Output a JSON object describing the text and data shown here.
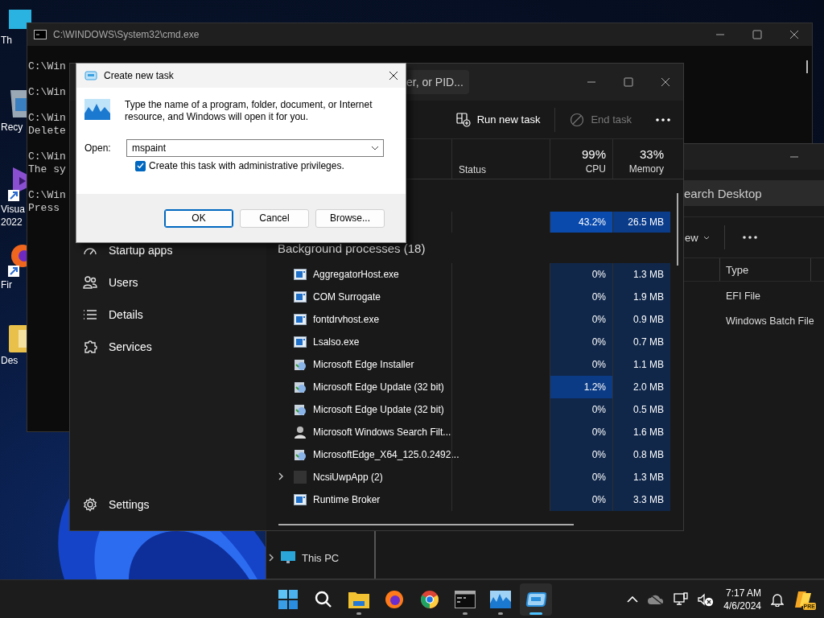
{
  "desktop": {
    "icons": [
      {
        "label": "Th",
        "kind": "monitor"
      },
      {
        "label": "Recy",
        "kind": "bin"
      },
      {
        "label": "Visua 2022",
        "kind": "vs"
      },
      {
        "label": "Fir",
        "kind": "firefox"
      },
      {
        "label": "Des",
        "kind": "folder"
      }
    ]
  },
  "file_explorer": {
    "search": {
      "placeholder": "earch Desktop"
    },
    "view_button": "ew",
    "columns": [
      {
        "label": "Type"
      }
    ],
    "rows": [
      {
        "type": "EFI File"
      },
      {
        "type": "Windows Batch File"
      }
    ],
    "nav": [
      {
        "label": "This PC",
        "expanded": false
      }
    ]
  },
  "cmd_window": {
    "title": "C:\\WINDOWS\\System32\\cmd.exe",
    "blocks": [
      [
        "C:\\Win"
      ],
      [
        "C:\\Win"
      ],
      [
        "C:\\Win",
        "Delete"
      ],
      [
        "C:\\Win",
        "The sy"
      ],
      [
        "C:\\Win",
        "Press"
      ]
    ]
  },
  "task_manager": {
    "search": {
      "placeholder": "er, or PID..."
    },
    "nav": [
      {
        "label": "Startup apps",
        "kind": "startup"
      },
      {
        "label": "Users",
        "kind": "users"
      },
      {
        "label": "Details",
        "kind": "details"
      },
      {
        "label": "Services",
        "kind": "services"
      }
    ],
    "settings": "Settings",
    "toolbar": [
      {
        "label": "Run new task",
        "kind": "run",
        "disabled": false
      },
      {
        "label": "End task",
        "kind": "end",
        "disabled": true
      }
    ],
    "columns": [
      {
        "label": "Status"
      },
      {
        "value": "99%",
        "label": "CPU"
      },
      {
        "value": "33%",
        "label": "Memory"
      }
    ],
    "app_rows": [
      {
        "cpu": "43.2%",
        "memory": "26.5 MB"
      }
    ],
    "group": "Background processes (18)",
    "processes": [
      {
        "name": "AggregatorHost.exe",
        "kind": "exe",
        "has_children": false,
        "cpu": "0%",
        "memory": "1.3 MB"
      },
      {
        "name": "COM Surrogate",
        "kind": "exe",
        "has_children": false,
        "cpu": "0%",
        "memory": "1.9 MB"
      },
      {
        "name": "fontdrvhost.exe",
        "kind": "exe",
        "has_children": false,
        "cpu": "0%",
        "memory": "0.9 MB"
      },
      {
        "name": "Lsalso.exe",
        "kind": "exe",
        "has_children": false,
        "cpu": "0%",
        "memory": "0.7 MB"
      },
      {
        "name": "Microsoft Edge Installer",
        "kind": "installer",
        "has_children": false,
        "cpu": "0%",
        "memory": "1.1 MB"
      },
      {
        "name": "Microsoft Edge Update (32 bit)",
        "kind": "installer",
        "has_children": false,
        "cpu": "1.2%",
        "memory": "2.0 MB"
      },
      {
        "name": "Microsoft Edge Update (32 bit)",
        "kind": "installer",
        "has_children": false,
        "cpu": "0%",
        "memory": "0.5 MB"
      },
      {
        "name": "Microsoft Windows Search Filt...",
        "kind": "user",
        "has_children": false,
        "cpu": "0%",
        "memory": "1.6 MB"
      },
      {
        "name": "MicrosoftEdge_X64_125.0.2492...",
        "kind": "installer",
        "has_children": false,
        "cpu": "0%",
        "memory": "0.8 MB"
      },
      {
        "name": "NcsiUwpApp (2)",
        "kind": "blank",
        "has_children": true,
        "cpu": "0%",
        "memory": "1.3 MB"
      },
      {
        "name": "Runtime Broker",
        "kind": "exe",
        "has_children": false,
        "cpu": "0%",
        "memory": "3.3 MB"
      }
    ]
  },
  "dialog": {
    "title": "Create new task",
    "message": "Type the name of a program, folder, document, or Internet resource, and Windows will open it for you.",
    "open_label": "Open:",
    "value": "mspaint",
    "admin": {
      "label": "Create this task with administrative privileges.",
      "checked": true
    },
    "buttons": [
      {
        "label": "OK",
        "default": true
      },
      {
        "label": "Cancel",
        "default": false
      },
      {
        "label": "Browse...",
        "default": false
      }
    ]
  },
  "taskbar": {
    "apps": [
      {
        "kind": "start",
        "running": false,
        "selected": false
      },
      {
        "kind": "search",
        "running": false,
        "selected": false
      },
      {
        "kind": "explorer",
        "running": true,
        "selected": false
      },
      {
        "kind": "firefox",
        "running": false,
        "selected": false
      },
      {
        "kind": "chrome",
        "running": false,
        "selected": false
      },
      {
        "kind": "cmd",
        "running": true,
        "selected": false
      },
      {
        "kind": "taskmgr",
        "running": true,
        "selected": false
      },
      {
        "kind": "run",
        "running": true,
        "selected": true
      }
    ],
    "clock": {
      "time": "7:17 AM",
      "date": "4/6/2024"
    },
    "copilot_badge": "PRE"
  }
}
